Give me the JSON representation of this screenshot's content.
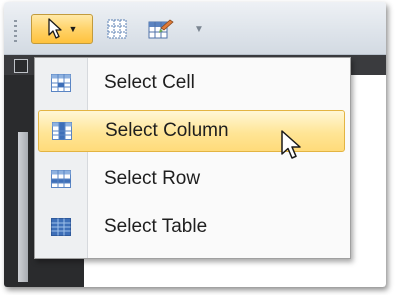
{
  "toolbar": {
    "buttons": [
      {
        "icon": "select-arrow-icon",
        "has_dropdown": true,
        "highlighted": true
      },
      {
        "icon": "grid-icon"
      },
      {
        "icon": "table-brush-icon"
      },
      {
        "icon": "more-dropdown-icon"
      }
    ]
  },
  "menu": {
    "items": [
      {
        "label": "Select Cell",
        "icon": "table-cell-icon"
      },
      {
        "label": "Select Column",
        "icon": "table-column-icon",
        "highlighted": true
      },
      {
        "label": "Select Row",
        "icon": "table-row-icon"
      },
      {
        "label": "Select Table",
        "icon": "table-icon"
      }
    ]
  },
  "colors": {
    "highlight": "#ffd36a",
    "menu_background": "#fafafa",
    "document_background": "#2a2b2d"
  }
}
